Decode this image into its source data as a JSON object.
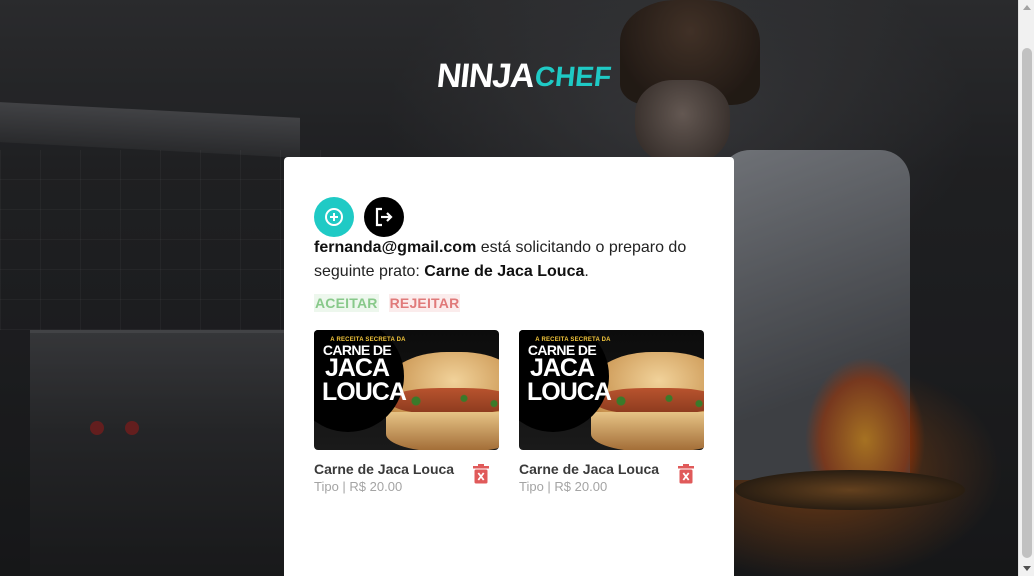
{
  "brand": {
    "name_part1": "NINJA",
    "name_part2": "CHEF",
    "accent_color": "#1fcac5"
  },
  "toolbar": {
    "add_icon": "plus-circle-icon",
    "logout_icon": "logout-icon"
  },
  "request": {
    "user_email": "fernanda@gmail.com",
    "text_middle": " está solicitando o preparo do seguinte prato: ",
    "dish_name": "Carne de Jaca Louca",
    "text_end": "."
  },
  "actions": {
    "accept_label": "ACEITAR",
    "reject_label": "REJEITAR"
  },
  "products": [
    {
      "name": "Carne de Jaca Louca",
      "meta": "Tipo | R$ 20.00",
      "image_tagline": "A RECEITA SECRETA DA",
      "image_title_line1": "CARNE DE",
      "image_title_line2": "JACA",
      "image_title_line3": "LOUCA",
      "delete_icon": "trash-icon"
    },
    {
      "name": "Carne de Jaca Louca",
      "meta": "Tipo | R$ 20.00",
      "image_tagline": "A RECEITA SECRETA DA",
      "image_title_line1": "CARNE DE",
      "image_title_line2": "JACA",
      "image_title_line3": "LOUCA",
      "delete_icon": "trash-icon"
    }
  ]
}
